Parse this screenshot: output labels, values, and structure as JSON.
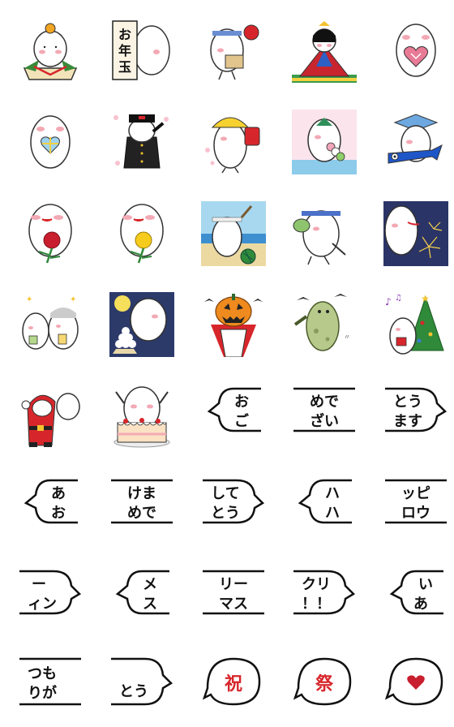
{
  "sheet": {
    "row1": {
      "c2_sign": "お年玉"
    },
    "bubbles": {
      "r5c3": [
        "お",
        "ご"
      ],
      "r5c4": [
        "めで",
        "ざい"
      ],
      "r5c5": [
        "とう",
        "ます"
      ],
      "r6c1": [
        "あ",
        "お"
      ],
      "r6c2": [
        "けま",
        "めで"
      ],
      "r6c3": [
        "して",
        "とう"
      ],
      "r6c4": [
        "ハ",
        "ハ"
      ],
      "r6c5": [
        "ッピ",
        "ロウ"
      ],
      "r7c1": [
        "ー",
        "ィン"
      ],
      "r7c2": [
        "メ",
        "ス"
      ],
      "r7c3": [
        "リー",
        "マス"
      ],
      "r7c4": [
        "クリ",
        "！！"
      ],
      "r7c5": [
        "い",
        "あ"
      ],
      "r8c1": [
        "つも",
        "りが"
      ],
      "r8c2": [
        "とう"
      ],
      "r8c3": [
        "祝"
      ],
      "r8c4": [
        "祭"
      ]
    }
  },
  "colors": {
    "red": "#d7262b",
    "outline": "#222222",
    "cheek": "#f3a9b4",
    "heart": "#c81e2e"
  }
}
